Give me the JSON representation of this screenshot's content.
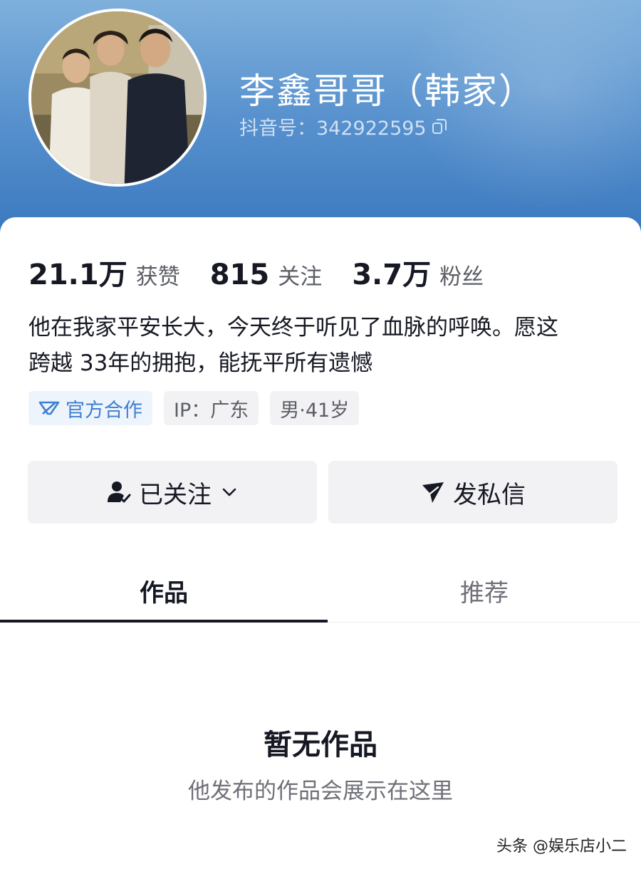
{
  "profile": {
    "nickname": "李鑫哥哥（韩家）",
    "douyin_id": "抖音号：342922595",
    "avatar_icon": "family-photo-avatar"
  },
  "stats": [
    {
      "value": "21.1万",
      "label": "获赞"
    },
    {
      "value": "815",
      "label": "关注"
    },
    {
      "value": "3.7万",
      "label": "粉丝"
    }
  ],
  "bio": {
    "line1": "他在我家平安长大，今天终于听见了血脉的呼唤。愿这",
    "line2": "跨越 33年的拥抱，能抚平所有遗憾"
  },
  "tags": {
    "official": "官方合作",
    "ip": "IP：广东",
    "gender_age": "男·41岁"
  },
  "actions": {
    "follow_label": "已关注",
    "message_label": "发私信"
  },
  "tabs": [
    {
      "label": "作品",
      "active": true
    },
    {
      "label": "推荐",
      "active": false
    }
  ],
  "empty_state": {
    "title": "暂无作品",
    "subtitle": "他发布的作品会展示在这里"
  },
  "watermark": "头条 @娱乐店小二",
  "colors": {
    "header_gradient_top": "#7fb0dc",
    "header_gradient_bottom": "#3a78bf",
    "official_tag": "#3f7fd0",
    "text_primary": "#161823",
    "text_secondary": "#5c5e66"
  }
}
